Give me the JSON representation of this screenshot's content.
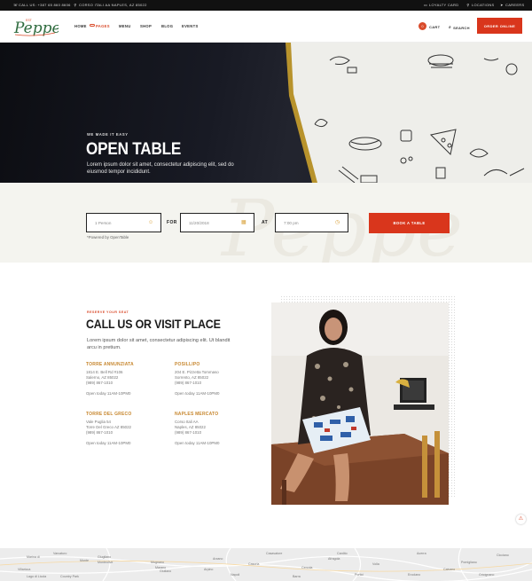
{
  "topbar": {
    "phone": "CALL US: +387 65 860 8606",
    "address": "CORSO ITALI AA NAPLES, AZ 85022",
    "loyalty": "LOYALTY CARD",
    "locations": "LOCATIONS",
    "careers": "CAREERS"
  },
  "header": {
    "logo_text": "Peppe",
    "logo_small": "EST",
    "nav": [
      "HOME",
      "PAGES",
      "MENU",
      "SHOP",
      "BLOG",
      "EVENTS"
    ],
    "cart_count": "0",
    "cart_label": "CART",
    "search_label": "SEARCH",
    "order_label": "ORDER ONLINE"
  },
  "hero": {
    "kicker": "WE MADE IT EASY",
    "title": "OPEN TABLE",
    "desc": "Lorem ipsum dolor sit amet, consectetur adipiscing elit, sed do eiusmod tempor incididunt."
  },
  "reservation": {
    "bg_script": "Peppe",
    "people_value": "1 Person",
    "for_label": "FOR",
    "date_value": "11/20/2018",
    "at_label": "AT",
    "time_value": "7:00 pm",
    "book_label": "BOOK A TABLE",
    "powered": "*Powered by OpenTable"
  },
  "visit": {
    "kicker": "RESERVE YOUR SEAT",
    "title": "CALL US OR VISIT PLACE",
    "desc": "Lorem ipsum dolor sit amet, consectetur adipiscing elit. Ut blandit arcu in pretium.",
    "locations": [
      {
        "name": "TORRE ANNUNZIATA",
        "line1": "1814 E. Bell Rd #106",
        "line2": "Salerno, AZ 85022",
        "line3": "(989) 867-1010",
        "hours": "Open today 11AM-10PM0"
      },
      {
        "name": "POSILLIPO",
        "line1": "204 E. Pizzetta Tommaso",
        "line2": "Sorrento, AZ 85022",
        "line3": "(989) 867-1010",
        "hours": "Open today 11AM-10PM0"
      },
      {
        "name": "TORRE DEL GRECO",
        "line1": "Vale Puglia 54",
        "line2": "Torre Del Greco AZ 85022",
        "line3": "(989) 867-1010",
        "hours": "Open today 11AM-10PM0"
      },
      {
        "name": "NAPLES MERCATO",
        "line1": "Corso Itali AA",
        "line2": "Naples, AZ 85022",
        "line3": "(989) 867-1010",
        "hours": "Open today 11AM-10PM0"
      }
    ]
  },
  "map": {
    "labels": [
      "Marina di",
      "Varcaturo",
      "Giugliano",
      "Casavatore",
      "Mugnano",
      "Cercola",
      "Marano",
      "Arzano",
      "Monte",
      "Monteolive",
      "Volla",
      "Villaricca",
      "Cicciano",
      "Acerra",
      "Pomigliano",
      "Casoria",
      "Ercolano",
      "Portici",
      "Giuliano",
      "Country Park",
      "Lago di Licola",
      "Napoli",
      "Afragola",
      "Arpino",
      "Cardito",
      "Caivano",
      "Barra",
      "Gricignano"
    ]
  },
  "colors": {
    "accent": "#d9361c",
    "gold": "#c7872f",
    "topbar": "#111111"
  }
}
